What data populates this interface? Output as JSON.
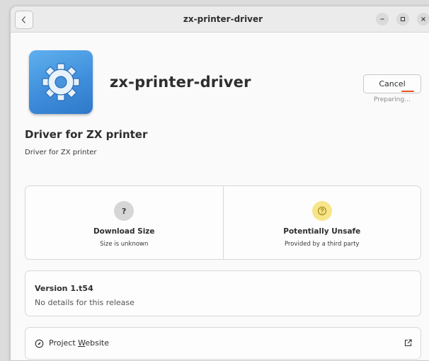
{
  "window": {
    "title": "zx-printer-driver"
  },
  "app": {
    "name": "zx-printer-driver",
    "icon": "gear-icon",
    "summary": "Driver for ZX printer",
    "description": "Driver for ZX printer"
  },
  "actions": {
    "cancel_label": "Cancel",
    "status": "Preparing…"
  },
  "tiles": [
    {
      "icon_text": "?",
      "icon": "question-icon",
      "title": "Download Size",
      "subtitle": "Size is unknown"
    },
    {
      "icon": "warning-icon",
      "title": "Potentially Unsafe",
      "subtitle": "Provided by a third party"
    }
  ],
  "version": {
    "title": "Version 1.t54",
    "details": "No details for this release"
  },
  "links": {
    "website_prefix": "Project ",
    "website_mnemonic": "W",
    "website_rest": "ebsite",
    "icon": "compass-icon",
    "external_icon": "external-link-icon"
  },
  "colors": {
    "accent": "#e95420",
    "app_icon_blue": "#3f8edc",
    "warning_badge": "#f7e58a"
  }
}
